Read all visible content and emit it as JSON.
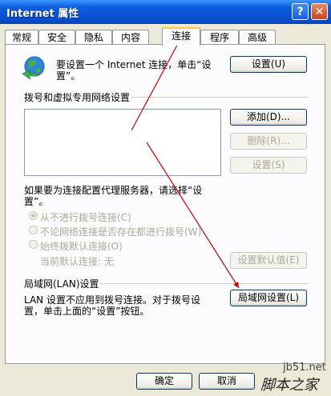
{
  "window": {
    "title": "Internet 属性",
    "help_label": "?",
    "close_label": "✕"
  },
  "tabs": [
    {
      "label": "常规"
    },
    {
      "label": "安全"
    },
    {
      "label": "隐私"
    },
    {
      "label": "内容"
    },
    {
      "label": "连接"
    },
    {
      "label": "程序"
    },
    {
      "label": "高级"
    }
  ],
  "active_tab": "连接",
  "setup": {
    "text": "要设置一个 Internet 连接，单击“设置”。",
    "button": "设置(U)"
  },
  "dialup": {
    "heading": "拨号和虚拟专用网络设置",
    "add_button": "添加(D)...",
    "remove_button": "删除(R)...",
    "settings_button": "设置(S)",
    "proxy_note": "如果要为连接配置代理服务器，请选择“设置”。",
    "options": [
      {
        "label": "从不进行拨号连接(C)",
        "checked": true
      },
      {
        "label": "不论网络连接是否存在都进行拨号(W)",
        "checked": false
      },
      {
        "label": "始终拨默认连接(O)",
        "checked": false
      }
    ],
    "current_default_label": "当前默认连接:",
    "current_default_value": "无",
    "set_default_button": "设置默认值(E)"
  },
  "lan": {
    "heading": "局域网(LAN)设置",
    "text": "LAN 设置不应用到拨号连接。对于拨号设置，单击上面的“设置”按钮。",
    "button": "局域网设置(L)"
  },
  "footer": {
    "ok_button": "确定",
    "cancel_button": "取消"
  },
  "watermark": {
    "site": "jb51.net",
    "brand": "脚本之家"
  },
  "colors": {
    "titlebar": "#0a5fe0",
    "background": "#ece9d8",
    "arrow": "#cc0000"
  }
}
